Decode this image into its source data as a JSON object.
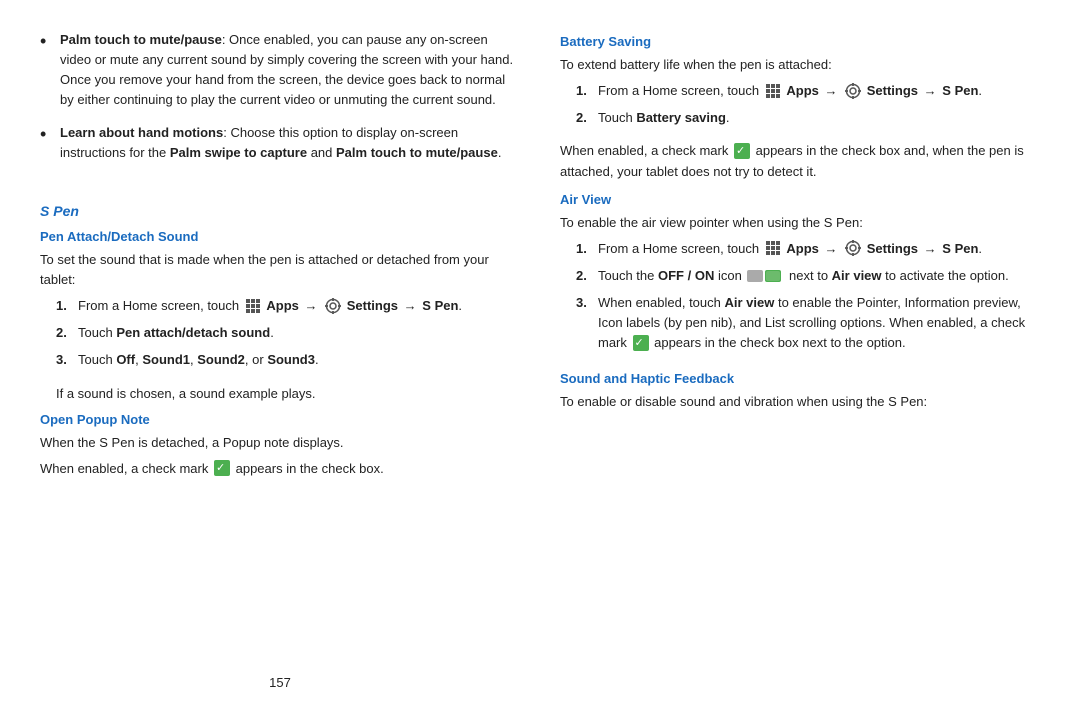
{
  "left": {
    "bullets": [
      {
        "term": "Palm touch to mute/pause",
        "text": ": Once enabled, you can pause any on-screen video or mute any current sound by simply covering the screen with your hand. Once you remove your hand from the screen, the device goes back to normal by either continuing to play the current video or unmuting the current sound."
      },
      {
        "term": "Learn about hand motions",
        "text": ": Choose this option to display on-screen instructions for the ",
        "bold2": "Palm swipe to capture",
        "text2": " and ",
        "bold3": "Palm touch to mute/pause",
        "text3": "."
      }
    ],
    "spen_heading": "S Pen",
    "pen_attach_heading": "Pen Attach/Detach Sound",
    "pen_attach_intro": "To set the sound that is made when the pen is attached or detached from your tablet:",
    "pen_attach_steps": [
      {
        "num": "1.",
        "text_before": "From a Home screen, touch",
        "apps": "Apps",
        "arrow1": "→",
        "settings": "Settings",
        "arrow2": "→",
        "spen": "S Pen",
        "period": "."
      },
      {
        "num": "2.",
        "bold": "Pen attach/detach sound",
        "text": "Touch ",
        "end": "."
      },
      {
        "num": "3.",
        "text": "Touch ",
        "bold1": "Off",
        "comma1": ", ",
        "bold2": "Sound1",
        "comma2": ", ",
        "bold3": "Sound2",
        "or": ", or ",
        "bold4": "Sound3",
        "end": "."
      }
    ],
    "pen_attach_note": "If a sound is chosen, a sound example plays.",
    "open_popup_heading": "Open Popup Note",
    "open_popup_text1": "When the S Pen is detached, a Popup note displays.",
    "open_popup_text2": "When enabled, a check mark",
    "open_popup_text2b": "appears in the check box.",
    "page_num": "157"
  },
  "right": {
    "battery_heading": "Battery Saving",
    "battery_intro": "To extend battery life when the pen is attached:",
    "battery_steps": [
      {
        "num": "1.",
        "text_before": "From a Home screen, touch",
        "apps": "Apps",
        "arrow1": "→",
        "settings": "Settings",
        "arrow2": "→",
        "spen": "S Pen",
        "period": "."
      },
      {
        "num": "2.",
        "text": "Touch ",
        "bold": "Battery saving",
        "end": "."
      }
    ],
    "battery_note1": "When enabled, a check mark",
    "battery_note2": "appears in the check box and, when the pen is attached, your tablet does not try to detect it.",
    "air_view_heading": "Air View",
    "air_view_intro": "To enable the air view pointer when using the S Pen:",
    "air_view_steps": [
      {
        "num": "1.",
        "text_before": "From a Home screen, touch",
        "apps": "Apps",
        "arrow1": "→",
        "settings": "Settings",
        "arrow2": "→",
        "spen": "S Pen",
        "period": "."
      },
      {
        "num": "2.",
        "text": "Touch the ",
        "bold": "OFF / ON",
        "text2": " icon",
        "text3": " next to ",
        "bold2": "Air view",
        "text4": " to activate the option.",
        "end": ""
      },
      {
        "num": "3.",
        "text": "When enabled, touch ",
        "bold": "Air view",
        "text2": " to enable the Pointer, Information preview, Icon labels (by pen nib), and List scrolling options. When enabled, a check mark",
        "text3": " appears in the check box next to the option.",
        "end": ""
      }
    ],
    "sound_haptic_heading": "Sound and Haptic Feedback",
    "sound_haptic_intro": "To enable or disable sound and vibration when using the S Pen:"
  },
  "icons": {
    "apps_label": "Apps",
    "settings_label": "Settings"
  }
}
